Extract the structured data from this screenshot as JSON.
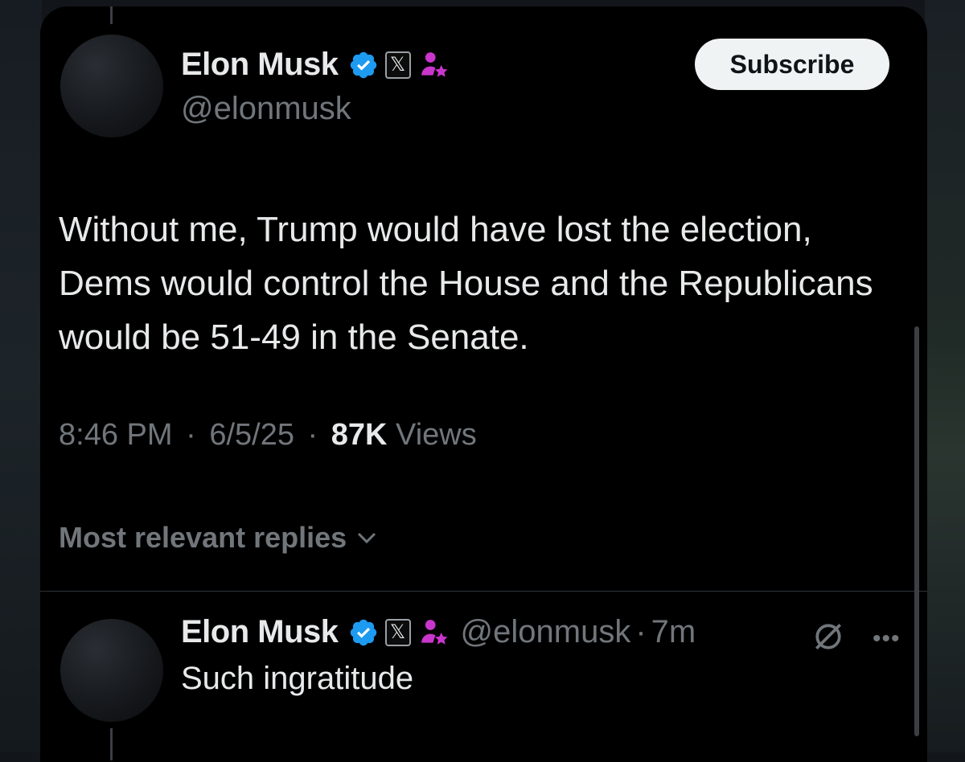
{
  "tweet": {
    "author_name": "Elon Musk",
    "author_handle": "@elonmusk",
    "subscribe_label": "Subscribe",
    "text": "Without me, Trump would have lost the election, Dems would control the House and the Republicans would be 51-49 in the Senate.",
    "time": "8:46 PM",
    "date": "6/5/25",
    "views_count": "87K",
    "views_label": "Views",
    "separator": "·"
  },
  "replies": {
    "sort_label": "Most relevant replies"
  },
  "reply": {
    "author_name": "Elon Musk",
    "author_handle": "@elonmusk",
    "separator": "·",
    "age": "7m",
    "text": "Such ingratitude",
    "more_label": "•••"
  },
  "badges": {
    "x_badge_glyph": "𝕏"
  },
  "colors": {
    "verified": "#1d9bf0",
    "affiliate": "#c936cc",
    "text_primary": "#e7e9ea",
    "text_secondary": "#71767b"
  }
}
